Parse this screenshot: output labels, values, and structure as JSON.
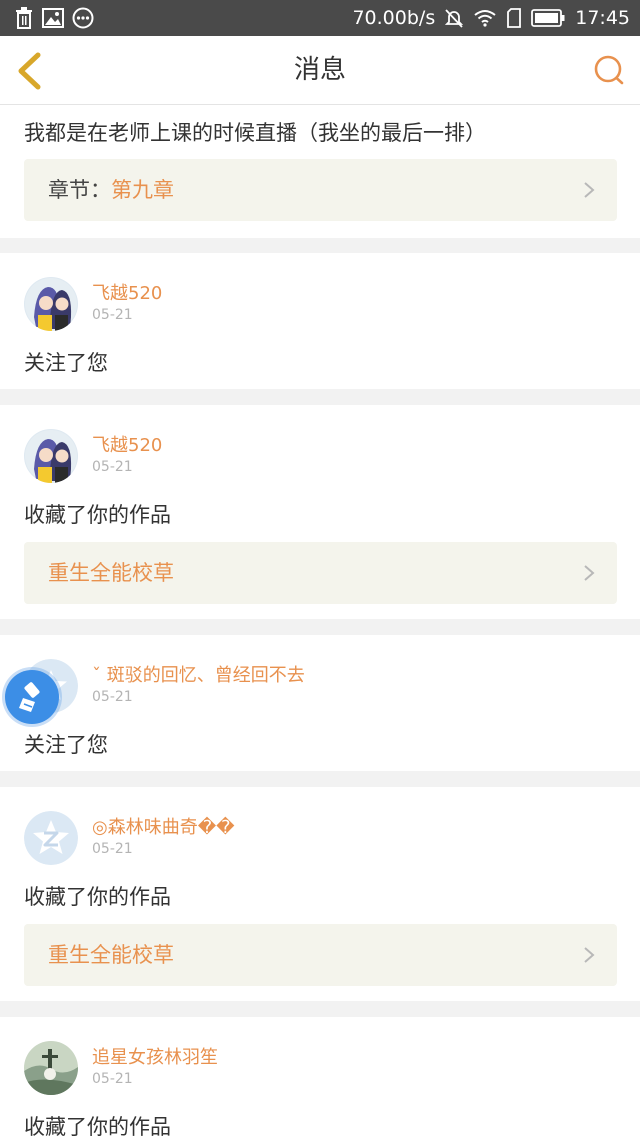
{
  "status_bar": {
    "network_speed": "70.00b/s",
    "time": "17:45",
    "left_icons": [
      "trash-icon",
      "image-icon",
      "more-dots-icon"
    ],
    "right_icons": [
      "mute-icon",
      "wifi-icon",
      "sim-icon",
      "battery-icon"
    ]
  },
  "nav": {
    "title": "消息",
    "back_icon": "chevron-left-icon",
    "search_icon": "search-icon"
  },
  "colors": {
    "accent": "#e8914e",
    "nav_back": "#d8a72a",
    "card_bg": "#ffffff",
    "page_bg": "#f2f2f2",
    "link_box_bg": "#f4f4ec",
    "date": "#b4b4b4",
    "status_bar": "#4a4a4a",
    "float_button": "#3c8ee6"
  },
  "feed": {
    "items": [
      {
        "text": "我都是在老师上课的时候直播（我坐的最后一排）",
        "link_prefix": "章节：",
        "link_value": "第九章"
      },
      {
        "username": "飞越520",
        "date": "05-21",
        "action": "关注了您",
        "avatar_icon": "anime-couple-avatar"
      },
      {
        "username": "飞越520",
        "date": "05-21",
        "action": "收藏了你的作品",
        "link_value": "重生全能校草",
        "avatar_icon": "anime-couple-avatar"
      },
      {
        "username": "ˇ 斑驳的回忆、曾经回不去",
        "date": "05-21",
        "action": "关注了您",
        "avatar_icon": "default-star-avatar"
      },
      {
        "username": "◎森林味曲奇��",
        "date": "05-21",
        "action": "收藏了你的作品",
        "link_value": "重生全能校草",
        "avatar_icon": "default-z-avatar"
      },
      {
        "username": "追星女孩林羽笙",
        "date": "05-21",
        "action": "收藏了你的作品",
        "avatar_icon": "photo-avatar"
      }
    ]
  },
  "floating_button": {
    "icon": "brush-icon"
  }
}
